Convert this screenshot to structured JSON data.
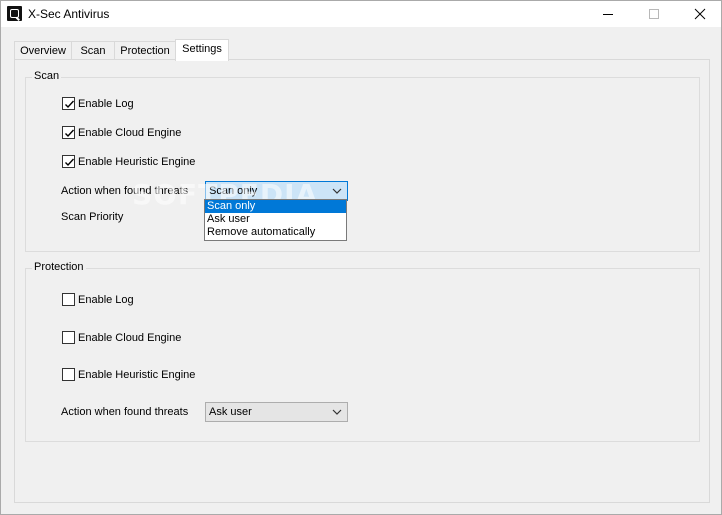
{
  "window": {
    "title": "X-Sec Antivirus",
    "controls": [
      "minimize",
      "maximize",
      "close"
    ]
  },
  "tabs": [
    {
      "label": "Overview",
      "active": false
    },
    {
      "label": "Scan",
      "active": false
    },
    {
      "label": "Protection",
      "active": false
    },
    {
      "label": "Settings",
      "active": true
    }
  ],
  "scan_group": {
    "title": "Scan",
    "enable_log": {
      "label": "Enable Log",
      "checked": true
    },
    "enable_cloud": {
      "label": "Enable Cloud Engine",
      "checked": true
    },
    "enable_heuristic": {
      "label": "Enable Heuristic Engine",
      "checked": true
    },
    "action_label": "Action when found threats",
    "action_value": "Scan only",
    "action_options": [
      "Scan only",
      "Ask user",
      "Remove automatically"
    ],
    "priority_label": "Scan Priority"
  },
  "protection_group": {
    "title": "Protection",
    "enable_log": {
      "label": "Enable Log",
      "checked": false
    },
    "enable_cloud": {
      "label": "Enable Cloud Engine",
      "checked": false
    },
    "enable_heuristic": {
      "label": "Enable Heuristic Engine",
      "checked": false
    },
    "action_label": "Action when found threats",
    "action_value": "Ask user"
  },
  "watermark": "SOFTPEDIA",
  "colors": {
    "accent": "#0078d7",
    "combo_open_bg": "#cce4f7",
    "window_bg": "#f0f0f0"
  }
}
